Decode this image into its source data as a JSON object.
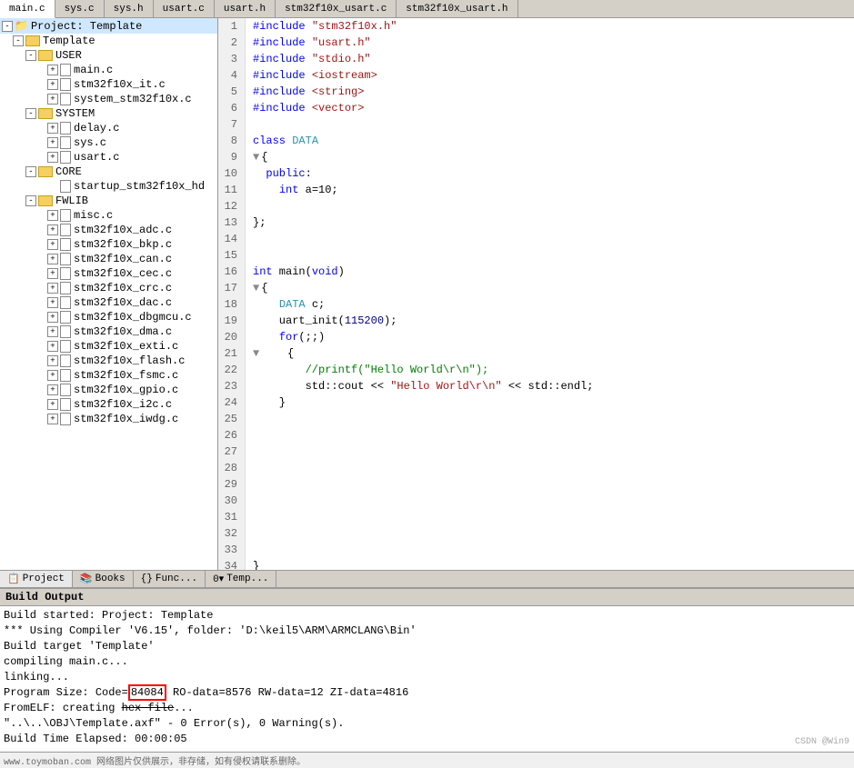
{
  "tabs": {
    "items": [
      {
        "label": "main.c",
        "active": true
      },
      {
        "label": "sys.c",
        "active": false
      },
      {
        "label": "sys.h",
        "active": false
      },
      {
        "label": "usart.c",
        "active": false
      },
      {
        "label": "usart.h",
        "active": false
      },
      {
        "label": "stm32f10x_usart.c",
        "active": false
      },
      {
        "label": "stm32f10x_usart.h",
        "active": false
      }
    ]
  },
  "sidebar": {
    "project_label": "Project: Template",
    "tree": [
      {
        "label": "Template",
        "type": "root",
        "level": 0,
        "expanded": true
      },
      {
        "label": "USER",
        "type": "folder",
        "level": 1,
        "expanded": true
      },
      {
        "label": "main.c",
        "type": "file",
        "level": 2
      },
      {
        "label": "stm32f10x_it.c",
        "type": "file",
        "level": 2
      },
      {
        "label": "system_stm32f10x.c",
        "type": "file",
        "level": 2
      },
      {
        "label": "SYSTEM",
        "type": "folder",
        "level": 1,
        "expanded": true
      },
      {
        "label": "delay.c",
        "type": "file",
        "level": 2
      },
      {
        "label": "sys.c",
        "type": "file",
        "level": 2
      },
      {
        "label": "usart.c",
        "type": "file",
        "level": 2
      },
      {
        "label": "CORE",
        "type": "folder",
        "level": 1,
        "expanded": true
      },
      {
        "label": "startup_stm32f10x_hd",
        "type": "file",
        "level": 2
      },
      {
        "label": "FWLIB",
        "type": "folder",
        "level": 1,
        "expanded": true
      },
      {
        "label": "misc.c",
        "type": "file",
        "level": 2
      },
      {
        "label": "stm32f10x_adc.c",
        "type": "file",
        "level": 2
      },
      {
        "label": "stm32f10x_bkp.c",
        "type": "file",
        "level": 2
      },
      {
        "label": "stm32f10x_can.c",
        "type": "file",
        "level": 2
      },
      {
        "label": "stm32f10x_cec.c",
        "type": "file",
        "level": 2
      },
      {
        "label": "stm32f10x_crc.c",
        "type": "file",
        "level": 2
      },
      {
        "label": "stm32f10x_dac.c",
        "type": "file",
        "level": 2
      },
      {
        "label": "stm32f10x_dbgmcu.c",
        "type": "file",
        "level": 2
      },
      {
        "label": "stm32f10x_dma.c",
        "type": "file",
        "level": 2
      },
      {
        "label": "stm32f10x_exti.c",
        "type": "file",
        "level": 2
      },
      {
        "label": "stm32f10x_flash.c",
        "type": "file",
        "level": 2
      },
      {
        "label": "stm32f10x_fsmc.c",
        "type": "file",
        "level": 2
      },
      {
        "label": "stm32f10x_gpio.c",
        "type": "file",
        "level": 2
      },
      {
        "label": "stm32f10x_i2c.c",
        "type": "file",
        "level": 2
      },
      {
        "label": "stm32f10x_iwdg.c",
        "type": "file",
        "level": 2
      }
    ]
  },
  "bottom_tabs": [
    {
      "label": "Project",
      "icon": "project"
    },
    {
      "label": "Books",
      "icon": "books"
    },
    {
      "label": "Func...",
      "icon": "func"
    },
    {
      "label": "0... Temp...",
      "icon": "temp"
    }
  ],
  "build_output": {
    "header": "Build Output",
    "lines": [
      "Build started: Project: Template",
      "*** Using Compiler 'V6.15', folder: 'D:\\keil5\\ARM\\ARMCLANG\\Bin'",
      "Build target 'Template'",
      "compiling main.c...",
      "linking...",
      "Program Size: Code=84084 RO-data=8576 RW-data=12 ZI-data=4816",
      "FromELF: creating hex file...",
      "\"..\\OBJ\\Template.axf\" - 0 Error(s), 0 Warning(s).",
      "Build Time Elapsed:  00:00:05"
    ],
    "highlight_value": "84084",
    "strikethrough_text": "hex file"
  },
  "watermark": "CSDN @Win9"
}
